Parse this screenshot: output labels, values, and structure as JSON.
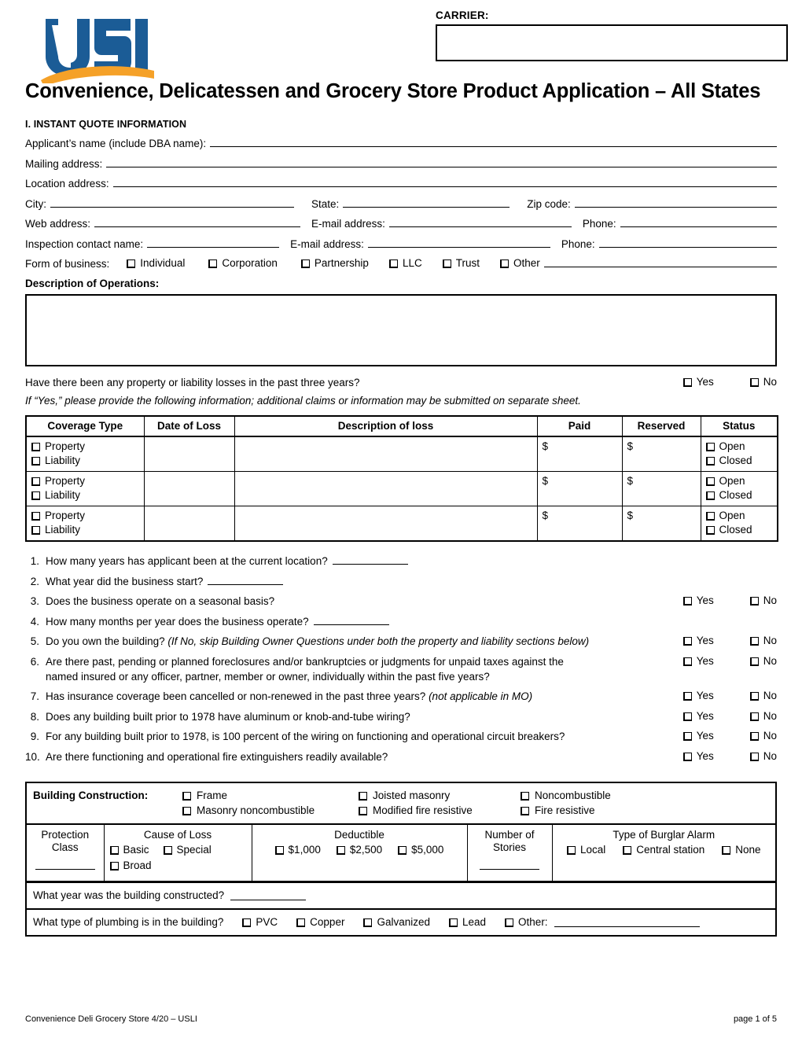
{
  "header": {
    "carrier_label": "CARRIER:",
    "carrier_value": "",
    "logo_alt": "USLI",
    "logo_blue": "#1B5C96",
    "logo_orange": "#F5A128"
  },
  "title": "Convenience, Delicatessen and Grocery Store Product Application – All States",
  "section_heading": "I. INSTANT QUOTE INFORMATION",
  "fields": {
    "applicant_name": "Applicant’s name (include DBA name):",
    "mailing_address": "Mailing address:",
    "location_address": "Location address:",
    "city": "City:",
    "state": "State:",
    "zip": "Zip code:",
    "web_address": "Web address:",
    "email_address": "E-mail address:",
    "phone": "Phone:",
    "inspection_contact": "Inspection contact name:",
    "email_address2": "E-mail address:",
    "phone2": "Phone:",
    "form_of_business": "Form of business:",
    "description_of_operations": "Description of Operations:",
    "description_value": ""
  },
  "form_of_business_options": [
    "Individual",
    "Corporation",
    "Partnership",
    "LLC",
    "Trust",
    "Other"
  ],
  "loss_question": {
    "text": "Have there been any property or liability losses in the past three years?",
    "yes": "Yes",
    "no": "No",
    "note": "If “Yes,” please provide the following information; additional claims or information may be submitted on separate sheet."
  },
  "loss_table": {
    "columns": [
      "Coverage Type",
      "Date of Loss",
      "Description of loss",
      "Paid",
      "Reserved",
      "Status"
    ],
    "coverage_options": [
      "Property",
      "Liability"
    ],
    "status_options": [
      "Open",
      "Closed"
    ],
    "currency_symbol": "$",
    "rows": [
      {
        "date_of_loss": "",
        "description": "",
        "paid": "",
        "reserved": ""
      },
      {
        "date_of_loss": "",
        "description": "",
        "paid": "",
        "reserved": ""
      },
      {
        "date_of_loss": "",
        "description": "",
        "paid": "",
        "reserved": ""
      }
    ]
  },
  "questions": [
    {
      "num": "1.",
      "text": "How many years has applicant been at the current location?",
      "blank": true,
      "yesno": false
    },
    {
      "num": "2.",
      "text": "What year did the business start?",
      "blank": true,
      "yesno": false
    },
    {
      "num": "3.",
      "text": "Does the business operate on a seasonal basis?",
      "blank": false,
      "yesno": true
    },
    {
      "num": "4.",
      "text": "How many months per year does the business operate?",
      "blank": true,
      "yesno": false
    },
    {
      "num": "5.",
      "text": "Do you own the building?",
      "italic": "(If No, skip Building Owner Questions under both the property and liability sections below)",
      "blank": false,
      "yesno": true
    },
    {
      "num": "6.",
      "text": "Are there past, pending or planned foreclosures and/or bankruptcies or judgments for unpaid taxes against the",
      "text2": "named insured or any officer, partner, member or owner, individually within the past five years?",
      "blank": false,
      "yesno": true
    },
    {
      "num": "7.",
      "text": "Has insurance coverage been cancelled or non-renewed in the past three years?",
      "italic": "(not applicable in MO)",
      "blank": false,
      "yesno": true
    },
    {
      "num": "8.",
      "text": "Does any building built prior to 1978 have aluminum or knob-and-tube wiring?",
      "blank": false,
      "yesno": true
    },
    {
      "num": "9.",
      "text": "For any building built prior to 1978, is 100 percent of the wiring on functioning and operational circuit breakers?",
      "blank": false,
      "yesno": true
    },
    {
      "num": "10.",
      "text": "Are there functioning and operational fire extinguishers readily available?",
      "blank": false,
      "yesno": true
    }
  ],
  "yes_label": "Yes",
  "no_label": "No",
  "building": {
    "construction_label": "Building Construction:",
    "construction_options": [
      "Frame",
      "Joisted masonry",
      "Noncombustible",
      "Masonry noncombustible",
      "Modified fire resistive",
      "Fire resistive"
    ],
    "protection_class_title": "Protection Class",
    "protection_class_value": "",
    "cause_of_loss_title": "Cause of Loss",
    "cause_of_loss_options": [
      "Basic",
      "Special",
      "Broad"
    ],
    "deductible_title": "Deductible",
    "deductible_options": [
      "$1,000",
      "$2,500",
      "$5,000"
    ],
    "stories_title": "Number of Stories",
    "stories_value": "",
    "burglar_title": "Type of Burglar Alarm",
    "burglar_options": [
      "Local",
      "Central station",
      "None"
    ],
    "year_built_question": "What year was the building constructed?",
    "year_built_value": "",
    "plumbing_question": "What type of plumbing is in the building?",
    "plumbing_options": [
      "PVC",
      "Copper",
      "Galvanized",
      "Lead"
    ],
    "plumbing_other_label": "Other:",
    "plumbing_other_value": ""
  },
  "footer": {
    "left": "Convenience Deli Grocery Store  4/20 – USLI",
    "right": "page 1 of 5"
  }
}
